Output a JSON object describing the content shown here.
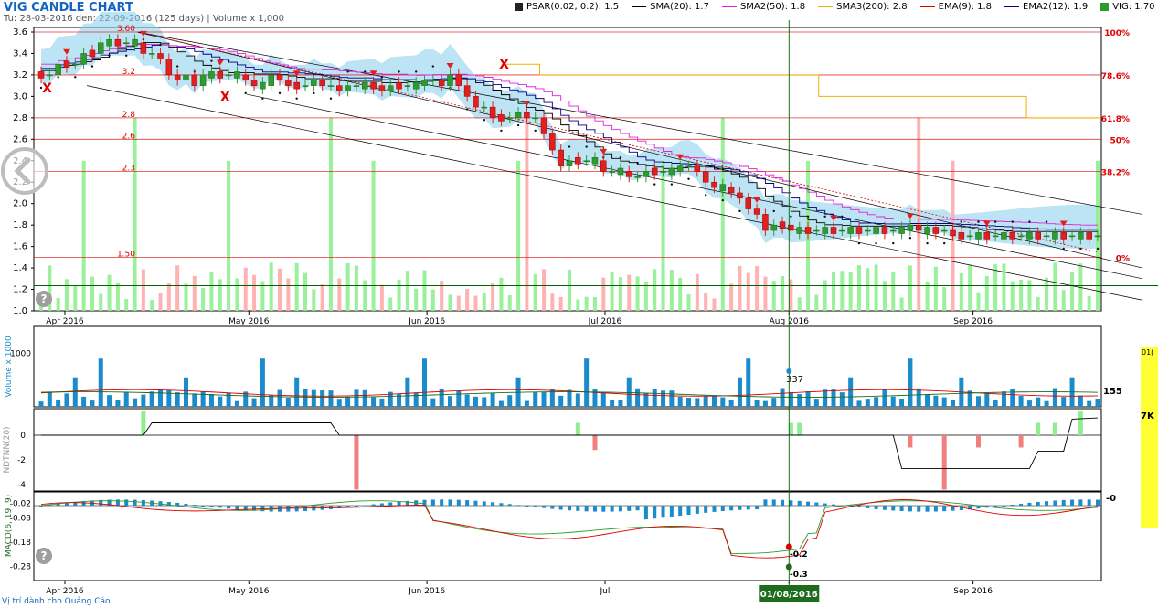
{
  "title": "VIG CANDLE CHART",
  "subtitle": "Tu: 28-03-2016 den: 22-09-2016 (125 days) | Volume x 1,000",
  "legend": [
    {
      "label": "PSAR(0.02, 0.2): 1.5",
      "color": "#222222",
      "kind": "square"
    },
    {
      "label": "SMA(20): 1.7",
      "color": "#000000",
      "kind": "line"
    },
    {
      "label": "SMA2(50): 1.8",
      "color": "#e020e0",
      "kind": "line"
    },
    {
      "label": "SMA3(200): 2.8",
      "color": "#f0b000",
      "kind": "line"
    },
    {
      "label": "EMA(9): 1.8",
      "color": "#e00000",
      "kind": "line"
    },
    {
      "label": "EMA2(12): 1.9",
      "color": "#000080",
      "kind": "line"
    },
    {
      "label": "VIG: 1.70",
      "color": "#2e9b2e",
      "kind": "square"
    }
  ],
  "footer": "Vị trí dành cho Quảng Cáo",
  "crosshair_label": "01/08/2016",
  "yellow_panel": {
    "top_label": "01(",
    "mid_label": "7K"
  },
  "colors": {
    "up": "#2e9b2e",
    "down": "#e02020",
    "volume_bar": "#1a8ccc",
    "vol_bg_up": "#90ee90",
    "vol_bg_down": "#ffaaaa",
    "cloud": "#87ceeb",
    "fib": "#e00000"
  },
  "chart_data": [
    {
      "type": "candlestick",
      "ylim": [
        1.0,
        3.6
      ],
      "y_ticks": [
        "1.0",
        "1.2",
        "1.4",
        "1.6",
        "1.8",
        "2.0",
        "2.2",
        "2.4",
        "2.6",
        "2.8",
        "3.0",
        "3.2",
        "3.4",
        "3.6"
      ],
      "x_tick_labels": [
        "Apr 2016",
        "May 2016",
        "Jun 2016",
        "Jul 2016",
        "Aug 2016",
        "Sep 2016"
      ],
      "x_tick_dates": [
        "2016-04-01",
        "2016-05-02",
        "2016-06-01",
        "2016-07-01",
        "2016-08-01",
        "2016-09-01"
      ],
      "date_range": [
        "2016-03-28",
        "2016-09-22"
      ],
      "fib_levels": [
        {
          "value": 3.6,
          "label": "100%"
        },
        {
          "value": 3.2,
          "label": "78.6%"
        },
        {
          "value": 2.8,
          "label": "61.8%"
        },
        {
          "value": 2.6,
          "label": "50%"
        },
        {
          "value": 2.3,
          "label": "38.2%"
        },
        {
          "value": 1.5,
          "label": "0%"
        }
      ],
      "fib_left_labels": [
        {
          "value": 3.6,
          "label": "3.60"
        },
        {
          "value": 3.2,
          "label": "3.2"
        },
        {
          "value": 2.8,
          "label": "2.8"
        },
        {
          "value": 2.6,
          "label": "2.6"
        },
        {
          "value": 2.3,
          "label": "2.3"
        },
        {
          "value": 1.5,
          "label": "1.50"
        }
      ],
      "x_markers": [
        {
          "date": "2016-03-29",
          "value": 3.08
        },
        {
          "date": "2016-04-28",
          "value": 3.0
        },
        {
          "date": "2016-06-14",
          "value": 3.3
        }
      ],
      "current_price": 1.7,
      "close_series": [
        3.2,
        3.2,
        3.3,
        3.3,
        3.3,
        3.4,
        3.4,
        3.5,
        3.5,
        3.5,
        3.5,
        3.5,
        3.4,
        3.4,
        3.35,
        3.2,
        3.15,
        3.2,
        3.1,
        3.2,
        3.2,
        3.2,
        3.2,
        3.2,
        3.15,
        3.1,
        3.1,
        3.2,
        3.15,
        3.1,
        3.1,
        3.1,
        3.15,
        3.1,
        3.1,
        3.05,
        3.1,
        3.1,
        3.1,
        3.1,
        3.05,
        3.1,
        3.1,
        3.1,
        3.1,
        3.15,
        3.15,
        3.1,
        3.2,
        3.1,
        3.0,
        2.9,
        2.9,
        2.8,
        2.8,
        2.8,
        2.85,
        2.8,
        2.8,
        2.65,
        2.5,
        2.35,
        2.4,
        2.4,
        2.4,
        2.4,
        2.3,
        2.3,
        2.3,
        2.25,
        2.25,
        2.3,
        2.3,
        2.3,
        2.3,
        2.35,
        2.35,
        2.3,
        2.2,
        2.15,
        2.15,
        2.1,
        2.05,
        1.95,
        1.9,
        1.75,
        1.8,
        1.8,
        1.75,
        1.75,
        1.75,
        1.75,
        1.75,
        1.75,
        1.75,
        1.75,
        1.75,
        1.75,
        1.75,
        1.75,
        1.75,
        1.75,
        1.8,
        1.75,
        1.75,
        1.75,
        1.75,
        1.7,
        1.7,
        1.7,
        1.7,
        1.7,
        1.7,
        1.7,
        1.7,
        1.7,
        1.7,
        1.7,
        1.7,
        1.7,
        1.7,
        1.7,
        1.7,
        1.7,
        1.7
      ]
    },
    {
      "type": "bar",
      "name": "Volume x 1000",
      "ylabel": "Volume x 1000",
      "y_ticks": [
        "1000"
      ],
      "last_value_label": "155",
      "crosshair_value_label": "337"
    },
    {
      "type": "bar",
      "name": "NDTNN(20)",
      "ylabel": "NDTNN(20)",
      "y_ticks": [
        "0",
        "-2",
        "-4"
      ]
    },
    {
      "type": "line",
      "name": "MACD(6, 19, 9)",
      "ylabel": "MACD(6, 19, 9)",
      "y_ticks": [
        "-0.02",
        "-0.08",
        "-0.18",
        "-0.28"
      ],
      "last_value_label": "-0",
      "crosshair_labels": [
        "-0.2",
        "-0.3"
      ]
    }
  ]
}
